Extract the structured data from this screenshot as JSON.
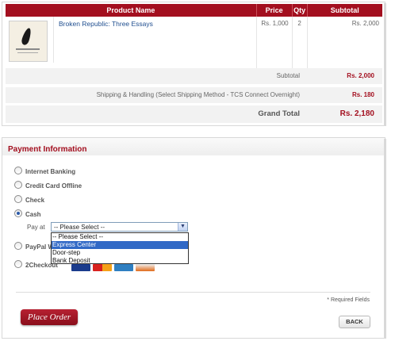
{
  "cart": {
    "headers": {
      "name": "Product Name",
      "price": "Price",
      "qty": "Qty",
      "subtotal": "Subtotal"
    },
    "items": [
      {
        "name": "Broken Republic: Three Essays",
        "price": "Rs. 1,000",
        "qty": "2",
        "subtotal": "Rs. 2,000",
        "thumbnail": "book-cover-feather"
      }
    ],
    "summary": {
      "subtotal_label": "Subtotal",
      "subtotal_value": "Rs. 2,000",
      "shipping_label": "Shipping & Handling (Select Shipping Method - TCS Connect Overnight)",
      "shipping_value": "Rs. 180",
      "total_label": "Grand Total",
      "total_value": "Rs. 2,180"
    }
  },
  "payment": {
    "title": "Payment Information",
    "methods": [
      {
        "label": "Internet Banking",
        "checked": false
      },
      {
        "label": "Credit Card Offline",
        "checked": false
      },
      {
        "label": "Check",
        "checked": false
      },
      {
        "label": "Cash",
        "checked": true
      },
      {
        "label": "PayPal W",
        "checked": false
      },
      {
        "label": "2Checkout",
        "checked": false
      }
    ],
    "pay_at_label": "Pay at",
    "select_value": "-- Please Select --",
    "options": [
      "-- Please Select --",
      "Express Center",
      "Door-step",
      "Bank Deposit"
    ],
    "highlighted_option": "Express Center",
    "required_note": "* Required Fields",
    "place_order_label": "Place Order",
    "back_label": "BACK"
  },
  "colors": {
    "accent": "#a30f1f",
    "link": "#1f4e8f",
    "highlight": "#3169c6"
  }
}
